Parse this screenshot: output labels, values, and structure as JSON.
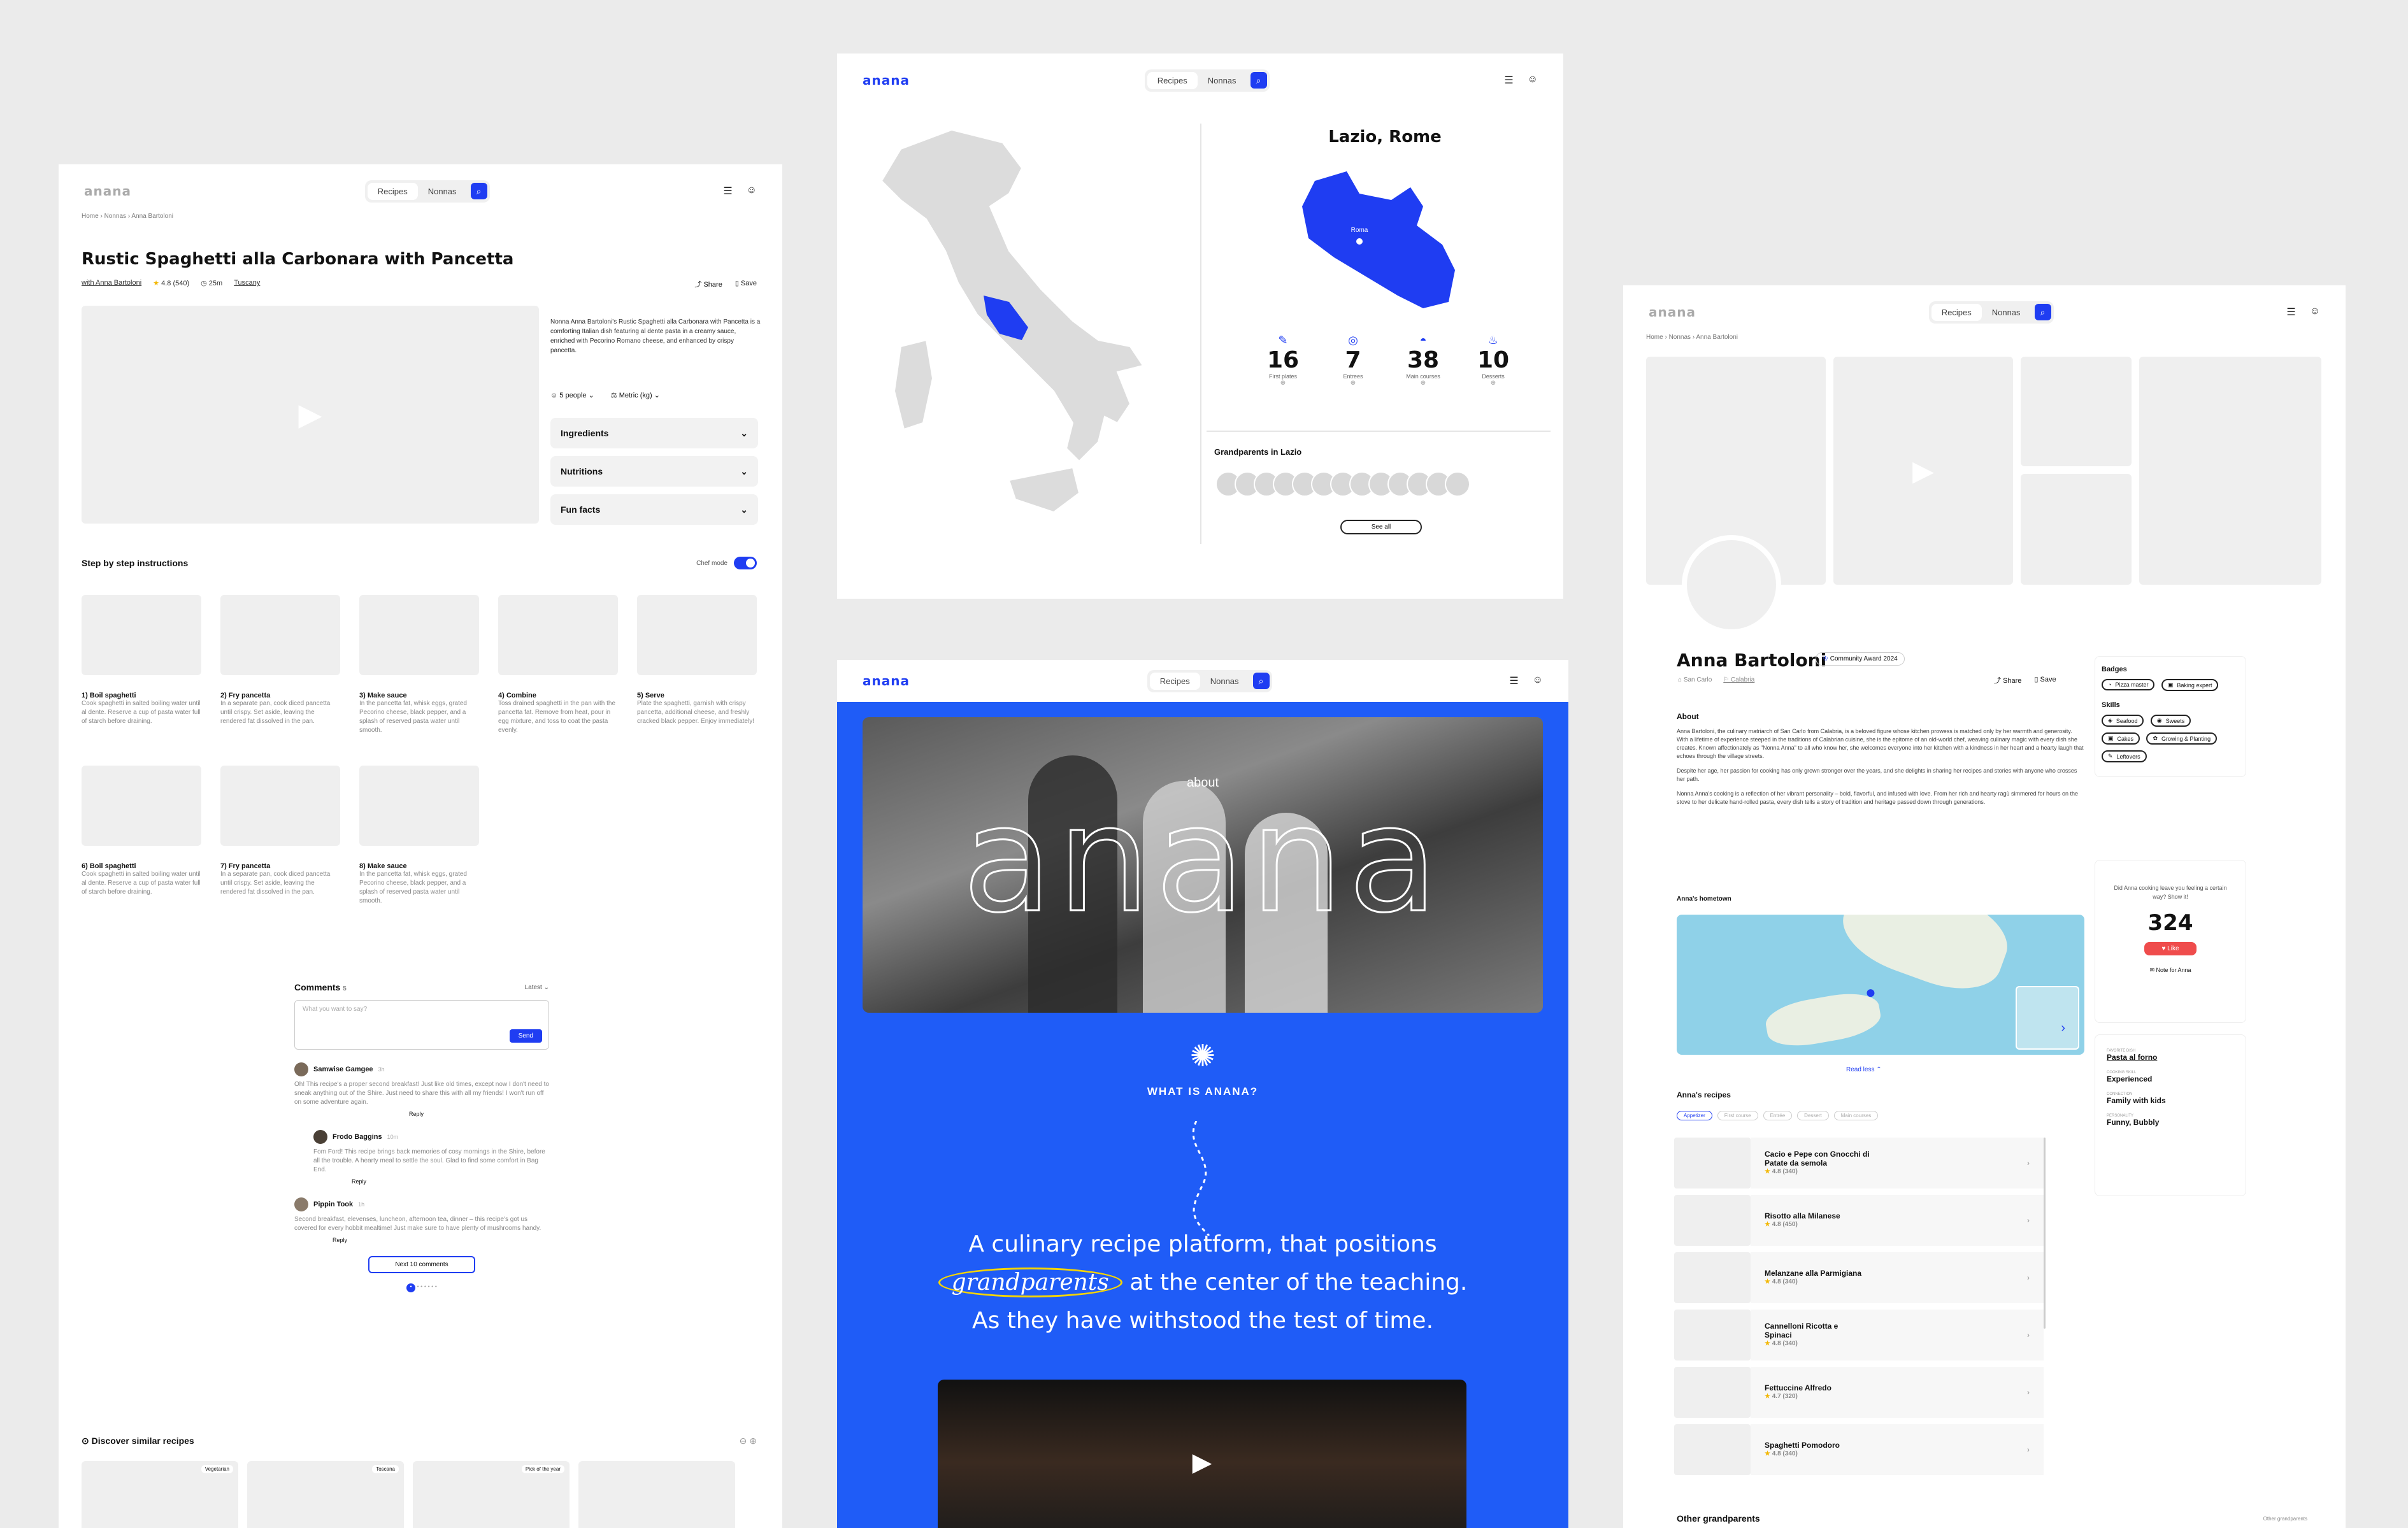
{
  "recipe_page": {
    "logo": "anana",
    "nav": {
      "recipes": "Recipes",
      "nonnas": "Nonnas"
    },
    "breadcrumb": [
      "Home",
      "Nonnas",
      "Anna Bartoloni"
    ],
    "title": "Rustic Spaghetti alla Carbonara with Pancetta",
    "meta": {
      "with": "with Anna Bartoloni",
      "rating": "4.8 (540)",
      "time": "25m",
      "region": "Tuscany"
    },
    "share": "Share",
    "save": "Save",
    "description": "Nonna Anna Bartoloni's Rustic Spaghetti alla Carbonara with Pancetta is a comforting Italian dish featuring al dente pasta in a creamy sauce, enriched with Pecorino Romano cheese, and enhanced by crispy pancetta.",
    "people": "5 people",
    "units": "Metric (kg)",
    "accordions": [
      "Ingredients",
      "Nutritions",
      "Fun facts"
    ],
    "steps_title": "Step by step instructions",
    "chef_mode": "Chef mode",
    "steps": [
      {
        "label": "1) Boil spaghetti",
        "text": "Cook spaghetti in salted boiling water until al dente. Reserve a cup of pasta water full of starch before draining."
      },
      {
        "label": "2) Fry pancetta",
        "text": "In a separate pan, cook diced pancetta until crispy. Set aside, leaving the rendered fat dissolved in the pan."
      },
      {
        "label": "3) Make sauce",
        "text": "In the pancetta fat, whisk eggs, grated Pecorino cheese, black pepper, and a splash of reserved pasta water until smooth."
      },
      {
        "label": "4) Combine",
        "text": "Toss drained spaghetti in the pan with the pancetta fat. Remove from heat, pour in egg mixture, and toss to coat the pasta evenly."
      },
      {
        "label": "5) Serve",
        "text": "Plate the spaghetti, garnish with crispy pancetta, additional cheese, and freshly cracked black pepper. Enjoy immediately!"
      },
      {
        "label": "6) Boil spaghetti",
        "text": "Cook spaghetti in salted boiling water until al dente. Reserve a cup of pasta water full of starch before draining."
      },
      {
        "label": "7) Fry pancetta",
        "text": "In a separate pan, cook diced pancetta until crispy. Set aside, leaving the rendered fat dissolved in the pan."
      },
      {
        "label": "8) Make sauce",
        "text": "In the pancetta fat, whisk eggs, grated Pecorino cheese, black pepper, and a splash of reserved pasta water until smooth."
      }
    ],
    "comments": {
      "title": "Comments",
      "count": "5",
      "sort": "Latest",
      "placeholder": "What you want to say?",
      "send": "Send",
      "items": [
        {
          "name": "Samwise Gamgee",
          "time": "3h",
          "text": "Oh! This recipe's a proper second breakfast! Just like old times, except now I don't need to sneak anything out of the Shire. Just need to share this with all my friends! I won't run off on some adventure again.",
          "reply": "Reply"
        },
        {
          "name": "Frodo Baggins",
          "time": "10m",
          "text": "Fom Ford! This recipe brings back memories of cosy mornings in the Shire, before all the trouble. A hearty meal to settle the soul. Glad to find some comfort in Bag End.",
          "reply": "Reply"
        },
        {
          "name": "Pippin Took",
          "time": "1h",
          "text": "Second breakfast, elevenses, luncheon, afternoon tea, dinner – this recipe's got us covered for every hobbit mealtime! Just make sure to have plenty of mushrooms handy.",
          "reply": "Reply"
        }
      ],
      "next": "Next 10 comments"
    },
    "similar_title": "Discover similar recipes",
    "similar_tags": [
      "Vegetarian",
      "Toscana",
      "Pick of the year"
    ]
  },
  "map_page": {
    "logo": "anana",
    "nav": {
      "recipes": "Recipes",
      "nonnas": "Nonnas"
    },
    "region_title": "Lazio, Rome",
    "region_pin": "Roma",
    "stats": [
      {
        "value": "16",
        "label": "First plates"
      },
      {
        "value": "7",
        "label": "Entrees"
      },
      {
        "value": "38",
        "label": "Main courses"
      },
      {
        "value": "10",
        "label": "Desserts"
      }
    ],
    "grandparents_title": "Grandparents in Lazio",
    "see_all": "See all"
  },
  "about_page": {
    "logo": "anana",
    "nav": {
      "recipes": "Recipes",
      "nonnas": "Nonnas"
    },
    "hero_small": "about",
    "hero_big": "anana",
    "what_is": "WHAT IS ANANA?",
    "line1": "A culinary recipe platform, that positions",
    "line2_em": "grandparents",
    "line2_rest": "at the center of the teaching.",
    "line3": "As they have withstood the test of time."
  },
  "profile_page": {
    "logo": "anana",
    "nav": {
      "recipes": "Recipes",
      "nonnas": "Nonnas"
    },
    "breadcrumb": [
      "Home",
      "Nonnas",
      "Anna Bartoloni"
    ],
    "name": "Anna Bartoloni",
    "award": "Community Award 2024",
    "town": "San Carlo",
    "region": "Calabria",
    "share": "Share",
    "save": "Save",
    "about_title": "About",
    "about": [
      "Anna Bartoloni, the culinary matriarch of San Carlo from Calabria, is a beloved figure whose kitchen prowess is matched only by her warmth and generosity. With a lifetime of experience steeped in the traditions of Calabrian cuisine, she is the epitome of an old-world chef, weaving culinary magic with every dish she creates. Known affectionately as \"Nonna Anna\" to all who know her, she welcomes everyone into her kitchen with a kindness in her heart and a hearty laugh that echoes through the village streets.",
      "Despite her age, her passion for cooking has only grown stronger over the years, and she delights in sharing her recipes and stories with anyone who crosses her path.",
      "Nonna Anna's cooking is a reflection of her vibrant personality – bold, flavorful, and infused with love. From her rich and hearty ragù simmered for hours on the stove to her delicate hand-rolled pasta, every dish tells a story of tradition and heritage passed down through generations."
    ],
    "hometown_title": "Anna's hometown",
    "read_less": "Read less",
    "recipes_title": "Anna's recipes",
    "recipe_tabs": [
      "Appetizer",
      "First course",
      "Entrée",
      "Dessert",
      "Main courses"
    ],
    "recipes": [
      {
        "name": "Cacio e Pepe con Gnocchi di Patate da semola",
        "rating": "4.8 (340)"
      },
      {
        "name": "Risotto alla Milanese",
        "rating": "4.8 (450)"
      },
      {
        "name": "Melanzane alla Parmigiana",
        "rating": "4.8 (340)"
      },
      {
        "name": "Cannelloni Ricotta e Spinaci",
        "rating": "4.8 (340)"
      },
      {
        "name": "Fettuccine Alfredo",
        "rating": "4.7 (320)"
      },
      {
        "name": "Spaghetti Pomodoro",
        "rating": "4.8 (340)"
      }
    ],
    "other_title": "Other grandparents",
    "other_link": "Other grandparents",
    "badges_title": "Badges",
    "badges": [
      "Pizza master",
      "Baking expert"
    ],
    "skills_title": "Skills",
    "skills": [
      "Seafood",
      "Sweets",
      "Cakes",
      "Growing & Planting",
      "Leftovers"
    ],
    "likes_prompt": "Did Anna cooking leave you feeling a certain way? Show it!",
    "likes": "324",
    "like_btn": "Like",
    "note": "Note for Anna",
    "facts": [
      {
        "label": "FAVORITE DISH",
        "value": "Pasta al forno"
      },
      {
        "label": "COOKING SKILL",
        "value": "Experienced"
      },
      {
        "label": "CONNECTION",
        "value": "Family with kids"
      },
      {
        "label": "PERSONALITY",
        "value": "Funny, Bubbly"
      }
    ]
  }
}
